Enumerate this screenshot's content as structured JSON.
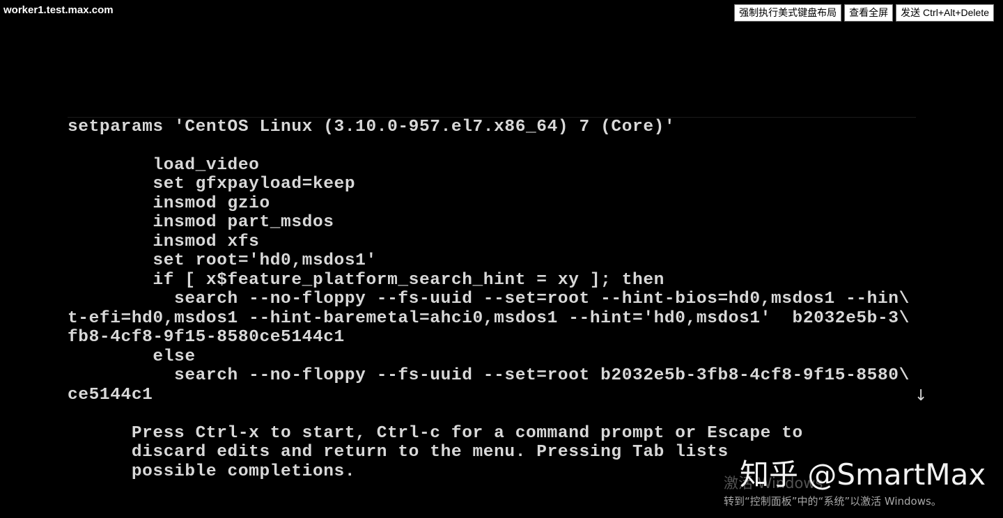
{
  "window": {
    "host_title": "worker1.test.max.com"
  },
  "toolbar": {
    "force_us_keyboard_label": "强制执行美式键盘布局",
    "fullscreen_label": "查看全屏",
    "send_cad_label": "发送 Ctrl+Alt+Delete"
  },
  "console": {
    "lines": [
      "setparams 'CentOS Linux (3.10.0-957.el7.x86_64) 7 (Core)'",
      "",
      "        load_video",
      "        set gfxpayload=keep",
      "        insmod gzio",
      "        insmod part_msdos",
      "        insmod xfs",
      "        set root='hd0,msdos1'",
      "        if [ x$feature_platform_search_hint = xy ]; then",
      "          search --no-floppy --fs-uuid --set=root --hint-bios=hd0,msdos1 --hin\\",
      "t-efi=hd0,msdos1 --hint-baremetal=ahci0,msdos1 --hint='hd0,msdos1'  b2032e5b-3\\",
      "fb8-4cf8-9f15-8580ce5144c1",
      "        else",
      "          search --no-floppy --fs-uuid --set=root b2032e5b-3fb8-4cf8-9f15-8580\\",
      "ce5144c1"
    ],
    "scroll_indicator": "↓",
    "help_lines": [
      "      Press Ctrl-x to start, Ctrl-c for a command prompt or Escape to",
      "      discard edits and return to the menu. Pressing Tab lists",
      "      possible completions."
    ]
  },
  "overlay": {
    "brand_watermark": "知乎 @SmartMax",
    "activate_title": "激活 Windows",
    "activate_subtitle": "转到“控制面板”中的“系统”以激活 Windows。"
  },
  "colors": {
    "background": "#000000",
    "terminal_text": "#d8d8d8",
    "button_bg": "#ffffff"
  }
}
